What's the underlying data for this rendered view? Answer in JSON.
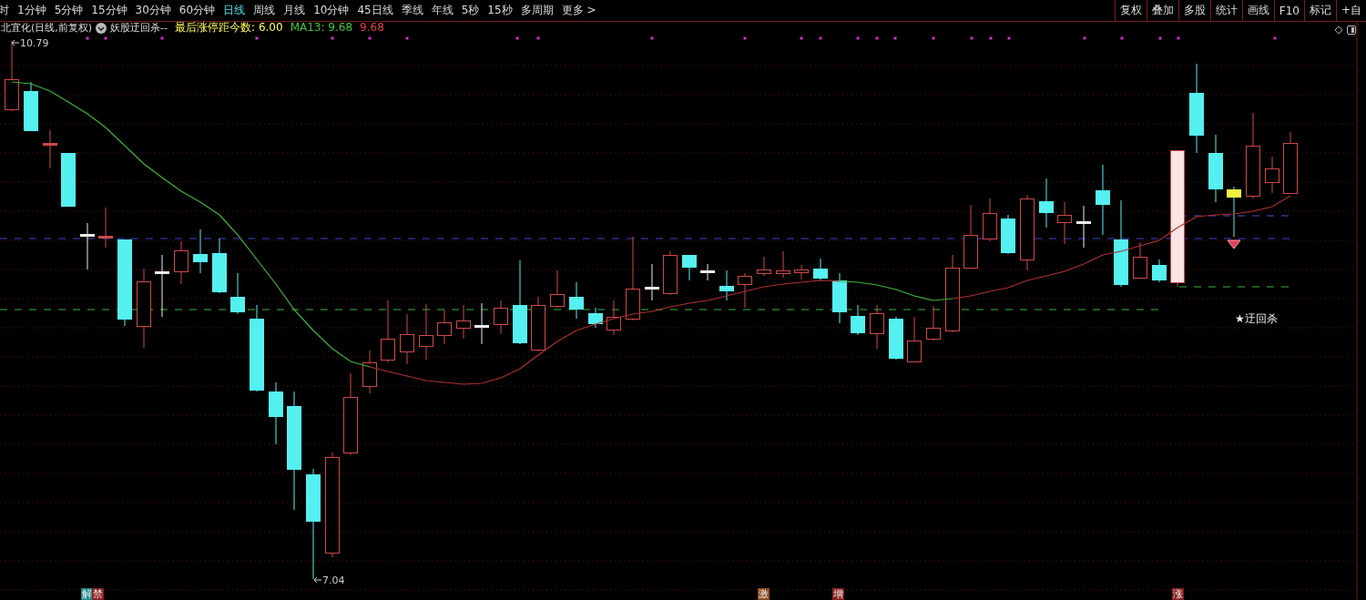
{
  "toolbar": {
    "tabs": [
      {
        "label": "时",
        "selected": false
      },
      {
        "label": "1分钟",
        "selected": false
      },
      {
        "label": "5分钟",
        "selected": false
      },
      {
        "label": "15分钟",
        "selected": false
      },
      {
        "label": "30分钟",
        "selected": false
      },
      {
        "label": "60分钟",
        "selected": false
      },
      {
        "label": "日线",
        "selected": true
      },
      {
        "label": "周线",
        "selected": false
      },
      {
        "label": "月线",
        "selected": false
      },
      {
        "label": "10分钟",
        "selected": false
      },
      {
        "label": "45日线",
        "selected": false
      },
      {
        "label": "季线",
        "selected": false
      },
      {
        "label": "年线",
        "selected": false
      },
      {
        "label": "5秒",
        "selected": false
      },
      {
        "label": "15秒",
        "selected": false
      },
      {
        "label": "多周期",
        "selected": false
      },
      {
        "label": "更多 >",
        "selected": false
      }
    ],
    "buttons": [
      "复权",
      "叠加",
      "多股",
      "统计",
      "画线",
      "F10",
      "标记",
      "+自"
    ]
  },
  "legend": {
    "title": "北宜化(日线,前复权)",
    "indicator": "妖股迂回杀--",
    "values": [
      {
        "text": "最后涨停距今数: 6.00",
        "color": "#ffff55"
      },
      {
        "text": "MA13: 9.68",
        "color": "#3cc83c"
      },
      {
        "text": "9.68",
        "color": "#e04040"
      }
    ]
  },
  "chart": {
    "high_label": "10.79",
    "low_label": "7.04",
    "signal_label": "★迂回杀",
    "events": [
      {
        "text": "解",
        "color": "#1f8a8a"
      },
      {
        "text": "禁",
        "color": "#8a1f1f"
      },
      {
        "text": "激",
        "color": "#8a4a1f"
      },
      {
        "text": "增",
        "color": "#8a1f1f"
      },
      {
        "text": "涨",
        "color": "#8a1f1f"
      }
    ]
  }
}
